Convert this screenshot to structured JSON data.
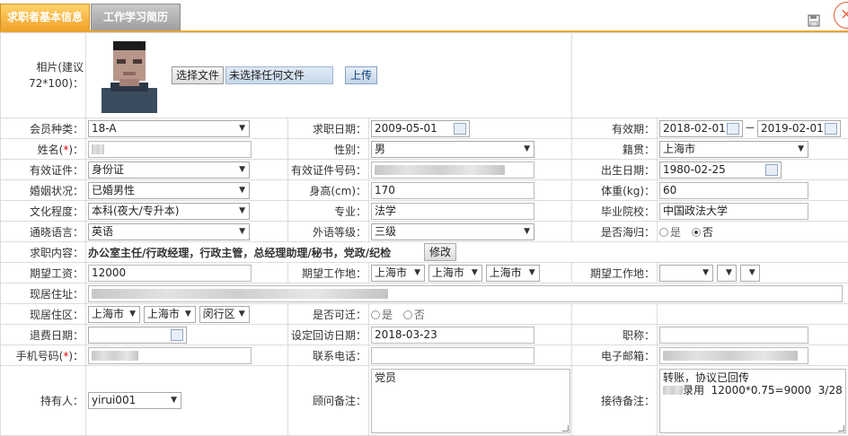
{
  "tabs": {
    "active": "求职者基本信息",
    "inactive": "工作学习简历"
  },
  "photo": {
    "label": "相片(建议72*100)：",
    "choose_file": "选择文件",
    "no_file": "未选择任何文件",
    "upload": "上传"
  },
  "row1": {
    "member_type_label": "会员种类：",
    "member_type": "18-A",
    "apply_date_label": "求职日期：",
    "apply_date": "2009-05-01",
    "validity_label": "有效期：",
    "validity_from": "2018-02-01",
    "validity_sep": "－",
    "validity_to": "2019-02-01"
  },
  "row2": {
    "name_label": "姓名",
    "gender_label": "性别：",
    "gender": "男",
    "native_label": "籍贯：",
    "native": "上海市"
  },
  "row3": {
    "id_type_label": "有效证件：",
    "id_type": "身份证",
    "id_no_label": "有效证件号码：",
    "birth_label": "出生日期：",
    "birth": "1980-02-25"
  },
  "row4": {
    "marital_label": "婚姻状况：",
    "marital": "已婚男性",
    "height_label": "身高(cm)：",
    "height": "170",
    "weight_label": "体重(kg)：",
    "weight": "60"
  },
  "row5": {
    "edu_label": "文化程度：",
    "edu": "本科(夜大/专升本)",
    "major_label": "专业：",
    "major": "法学",
    "school_label": "毕业院校：",
    "school": "中国政法大学"
  },
  "row6": {
    "lang_label": "通晓语言：",
    "lang": "英语",
    "lang_level_label": "外语等级：",
    "lang_level": "三级",
    "overseas_label": "是否海归：",
    "overseas_yes": "是",
    "overseas_no": "否"
  },
  "row7": {
    "content_label": "求职内容：",
    "content": "办公室主任/行政经理，行政主管，总经理助理/秘书，党政/纪检",
    "modify": "修改"
  },
  "row8": {
    "salary_label": "期望工资：",
    "salary": "12000",
    "work_place_label": "期望工作地：",
    "wp1": "上海市",
    "wp2": "上海市",
    "wp3": "上海市",
    "work_place_label2": "期望工作地："
  },
  "row9": {
    "address_label": "现居住址："
  },
  "row10": {
    "area_label": "现居住区：",
    "area1": "上海市",
    "area2": "上海市",
    "area3": "闵行区",
    "relocate_label": "是否可迁：",
    "relocate_yes": "是",
    "relocate_no": "否"
  },
  "row11": {
    "refund_label": "退费日期：",
    "revisit_label": "设定回访日期：",
    "revisit": "2018-03-23",
    "title_label": "职称："
  },
  "row12": {
    "mobile_label": "手机号码",
    "phone_label": "联系电话：",
    "email_label": "电子邮箱："
  },
  "row13": {
    "holder_label": "持有人：",
    "holder": "yirui001",
    "advisor_note_label": "顾问备注：",
    "advisor_note": "党员",
    "reception_note_label": "接待备注：",
    "reception_note_line1": "转账，协议已回传",
    "reception_note_line2": "录用  12000*0.75=9000  3/28"
  }
}
